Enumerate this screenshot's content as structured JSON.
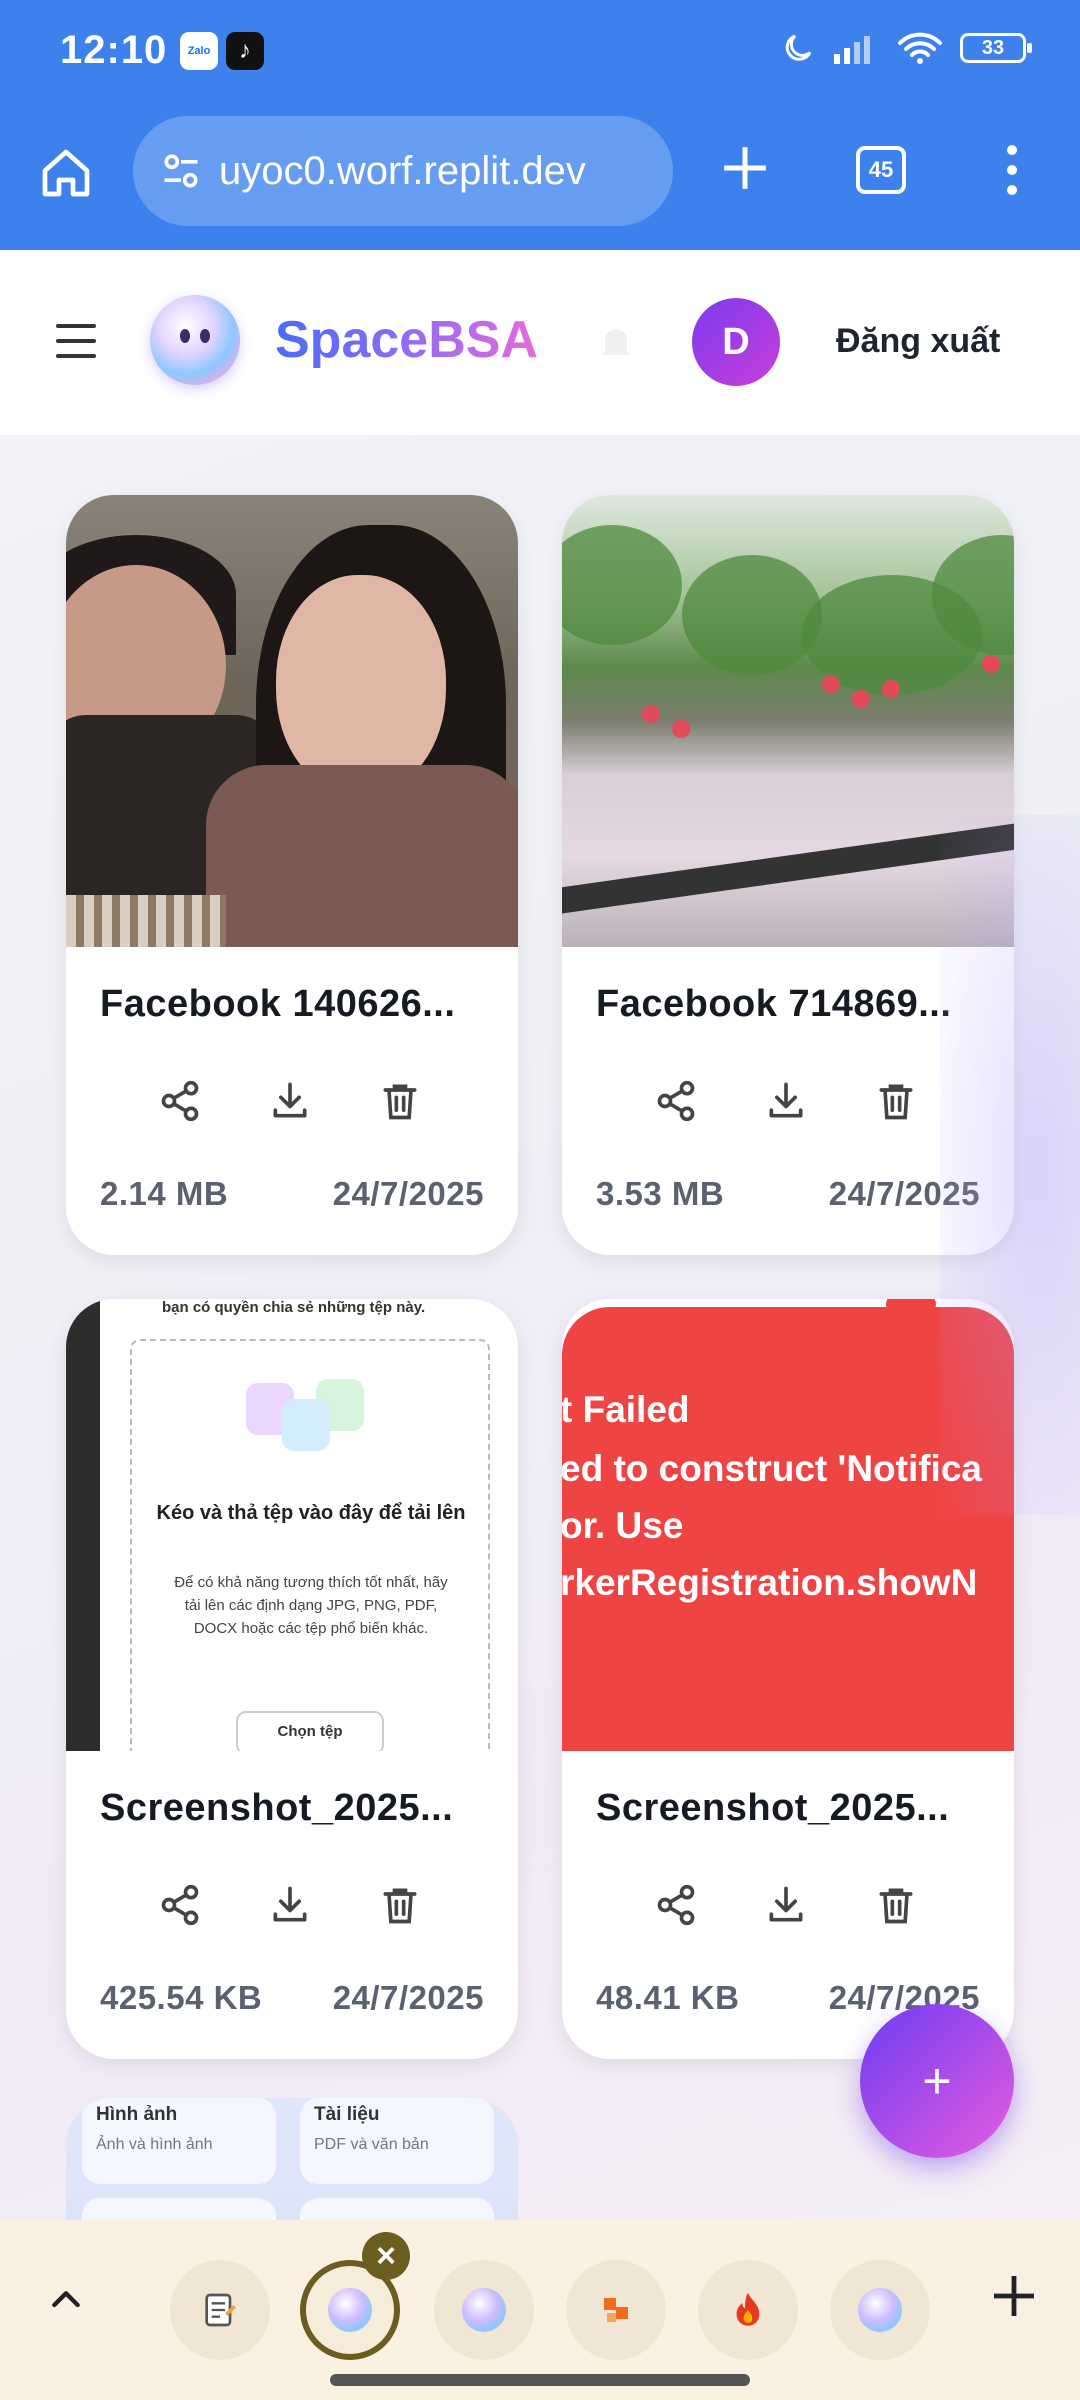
{
  "status_bar": {
    "time": "12:10",
    "zalo_label": "Zalo",
    "tiktok_glyph": "♪",
    "battery": "33"
  },
  "browser": {
    "url": "uyoc0.worf.replit.dev",
    "tab_count": "45"
  },
  "header": {
    "brand": "SpaceBSA",
    "avatar_letter": "D",
    "logout_label": "Đăng xuất"
  },
  "files": [
    {
      "name": "Facebook 140626...",
      "size": "2.14 MB",
      "date": "24/7/2025",
      "thumb": "photo-two-women"
    },
    {
      "name": "Facebook 714869...",
      "size": "3.53 MB",
      "date": "24/7/2025",
      "thumb": "photo-garden-flood"
    },
    {
      "name": "Screenshot_2025...",
      "size": "425.54 KB",
      "date": "24/7/2025",
      "thumb": "screenshot-upload"
    },
    {
      "name": "Screenshot_2025...",
      "size": "48.41 KB",
      "date": "24/7/2025",
      "thumb": "screenshot-error"
    }
  ],
  "upload_screenshot": {
    "top_text": "bạn có quyền chia sẻ những tệp này.",
    "title": "Kéo và thả tệp vào đây để tải lên",
    "desc": "Để có khả năng tương thích tốt nhất, hãy tải lên các định dạng JPG, PNG, PDF, DOCX hoặc các tệp phổ biến khác.",
    "button": "Chọn tệp"
  },
  "error_screenshot": {
    "line1": "t Failed",
    "line2": "ed to construct 'Notifica",
    "line3": "or. Use",
    "line4": "rkerRegistration.showN"
  },
  "partial_card": {
    "cat1_title": "Hình ảnh",
    "cat1_sub": "Ảnh và hình ảnh",
    "cat2_title": "Tài liệu",
    "cat2_sub": "PDF và văn bản"
  },
  "fab_label": "+",
  "icons": {
    "home": "home-icon",
    "tune": "tune-icon",
    "plus": "plus-icon",
    "more": "more-vert-icon",
    "share": "share-icon",
    "download": "download-icon",
    "delete": "trash-icon",
    "bell": "bell-icon"
  },
  "colors": {
    "browser_bar": "#3d82ec",
    "fab_start": "#6d3cf3",
    "fab_end": "#e55ce0",
    "error_red": "#ef4444",
    "tab_strip": "#fbf1e3"
  }
}
